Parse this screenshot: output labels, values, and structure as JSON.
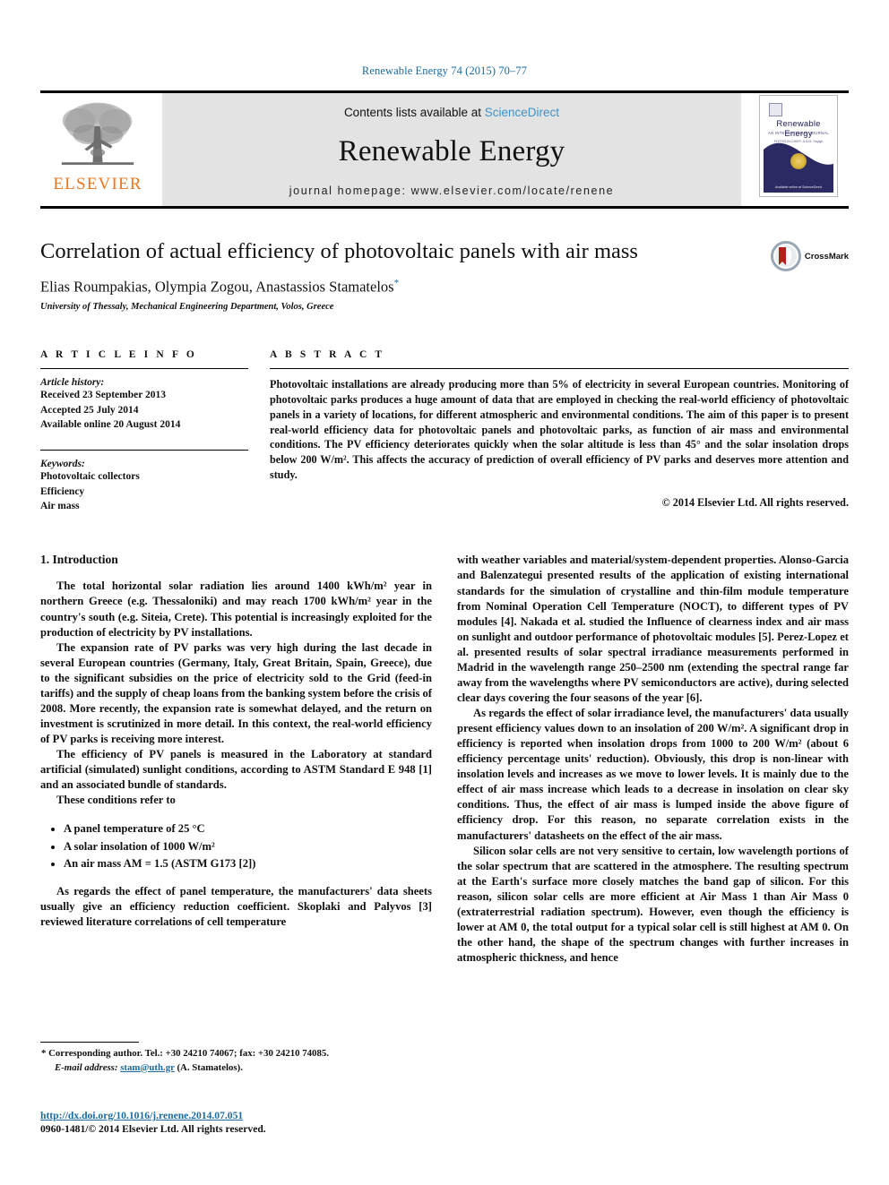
{
  "running_head": "Renewable Energy 74 (2015) 70–77",
  "masthead": {
    "publisher_word": "ELSEVIER",
    "contents_prefix": "Contents lists available at ",
    "contents_link": "ScienceDirect",
    "journal_title": "Renewable Energy",
    "homepage": "journal homepage: www.elsevier.com/locate/renene",
    "cover": {
      "title": "Renewable Energy",
      "subtitle": "AN INTERNATIONAL JOURNAL",
      "subtitle2": "EDITOR-IN-CHIEF: A.A.M. Sayigh",
      "footer": "Available online at\nScienceDirect"
    }
  },
  "article": {
    "title": "Correlation of actual efficiency of photovoltaic panels with air mass",
    "authors": "Elias Roumpakias, Olympia Zogou, Anastassios Stamatelos",
    "author_star": "*",
    "affiliation": "University of Thessaly, Mechanical Engineering Department, Volos, Greece",
    "crossmark_label": "CrossMark"
  },
  "article_info": {
    "heading": "A R T I C L E  I N F O",
    "history_label": "Article history:",
    "history": [
      "Received 23 September 2013",
      "Accepted 25 July 2014",
      "Available online 20 August 2014"
    ],
    "keywords_label": "Keywords:",
    "keywords": [
      "Photovoltaic collectors",
      "Efficiency",
      "Air mass"
    ]
  },
  "abstract": {
    "heading": "A B S T R A C T",
    "text": "Photovoltaic installations are already producing more than 5% of electricity in several European countries. Monitoring of photovoltaic parks produces a huge amount of data that are employed in checking the real-world efficiency of photovoltaic panels in a variety of locations, for different atmospheric and environmental conditions. The aim of this paper is to present real-world efficiency data for photovoltaic panels and photovoltaic parks, as function of air mass and environmental conditions. The PV efficiency deteriorates quickly when the solar altitude is less than 45° and the solar insolation drops below 200 W/m². This affects the accuracy of prediction of overall efficiency of PV parks and deserves more attention and study.",
    "copyright": "© 2014 Elsevier Ltd. All rights reserved."
  },
  "body": {
    "section_title": "1. Introduction",
    "left_paras": [
      "The total horizontal solar radiation lies around 1400 kWh/m² year in northern Greece (e.g. Thessaloniki) and may reach 1700 kWh/m² year in the country's south (e.g. Siteia, Crete). This potential is increasingly exploited for the production of electricity by PV installations.",
      "The expansion rate of PV parks was very high during the last decade in several European countries (Germany, Italy, Great Britain, Spain, Greece), due to the significant subsidies on the price of electricity sold to the Grid (feed-in tariffs) and the supply of cheap loans from the banking system before the crisis of 2008. More recently, the expansion rate is somewhat delayed, and the return on investment is scrutinized in more detail. In this context, the real-world efficiency of PV parks is receiving more interest.",
      "The efficiency of PV panels is measured in the Laboratory at standard artificial (simulated) sunlight conditions, according to ASTM Standard E 948 [1] and an associated bundle of standards.",
      "These conditions refer to"
    ],
    "bullets": [
      "A panel temperature of 25 °C",
      "A solar insolation of 1000 W/m²",
      "An air mass AM = 1.5 (ASTM G173 [2])"
    ],
    "left_paras_after": [
      "As regards the effect of panel temperature, the manufacturers' data sheets usually give an efficiency reduction coefficient. Skoplaki and Palyvos [3] reviewed literature correlations of cell temperature"
    ],
    "right_paras": [
      "with weather variables and material/system-dependent properties. Alonso-Garcia and Balenzategui presented results of the application of existing international standards for the simulation of crystalline and thin-film module temperature from Nominal Operation Cell Temperature (NOCT), to different types of PV modules [4]. Nakada et al. studied the Influence of clearness index and air mass on sunlight and outdoor performance of photovoltaic modules [5]. Perez-Lopez et al. presented results of solar spectral irradiance measurements performed in Madrid in the wavelength range 250–2500 nm (extending the spectral range far away from the wavelengths where PV semiconductors are active), during selected clear days covering the four seasons of the year [6].",
      "As regards the effect of solar irradiance level, the manufacturers' data usually present efficiency values down to an insolation of 200 W/m². A significant drop in efficiency is reported when insolation drops from 1000 to 200 W/m² (about 6 efficiency percentage units' reduction). Obviously, this drop is non-linear with insolation levels and increases as we move to lower levels. It is mainly due to the effect of air mass increase which leads to a decrease in insolation on clear sky conditions. Thus, the effect of air mass is lumped inside the above figure of efficiency drop. For this reason, no separate correlation exists in the manufacturers' datasheets on the effect of the air mass.",
      "Silicon solar cells are not very sensitive to certain, low wavelength portions of the solar spectrum that are scattered in the atmosphere. The resulting spectrum at the Earth's surface more closely matches the band gap of silicon. For this reason, silicon solar cells are more efficient at Air Mass 1 than Air Mass 0 (extraterrestrial radiation spectrum). However, even though the efficiency is lower at AM 0, the total output for a typical solar cell is still highest at AM 0. On the other hand, the shape of the spectrum changes with further increases in atmospheric thickness, and hence"
    ]
  },
  "footer": {
    "corresponding_marker": "*",
    "corresponding": "Corresponding author. Tel.: +30 24210 74067; fax: +30 24210 74085.",
    "email_label": "E-mail address:",
    "email": "stam@uth.gr",
    "email_suffix": "(A. Stamatelos).",
    "doi": "http://dx.doi.org/10.1016/j.renene.2014.07.051",
    "issn": "0960-1481/© 2014 Elsevier Ltd. All rights reserved."
  },
  "colors": {
    "link": "#1a6ba0",
    "sciencedirect": "#3c92c9",
    "elsevier_orange": "#E87722",
    "cover_navy": "#2b2a62"
  }
}
